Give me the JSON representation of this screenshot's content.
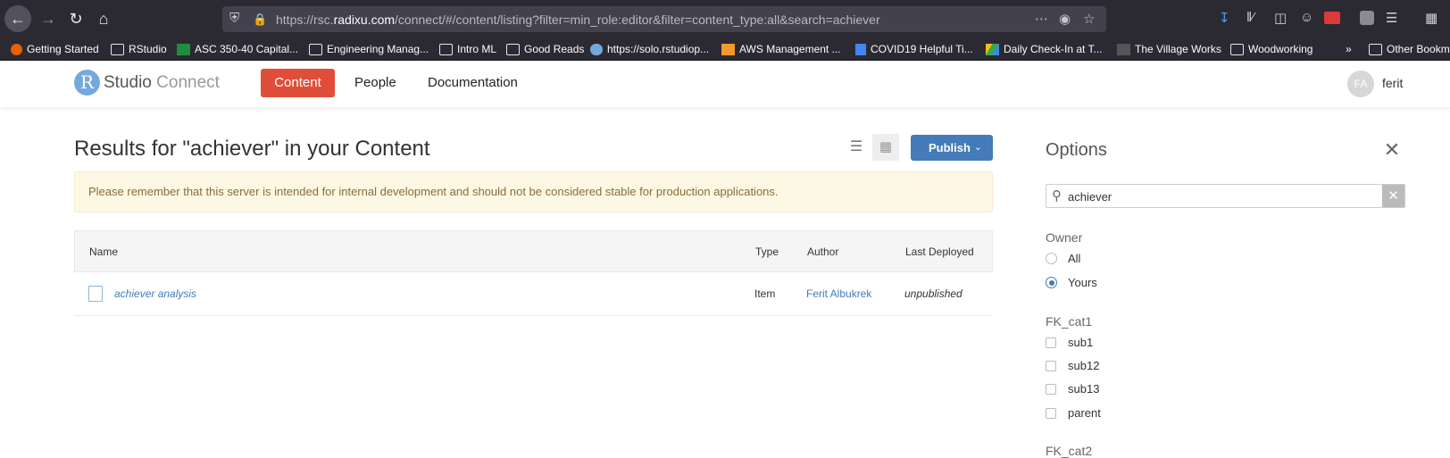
{
  "browser": {
    "url_prefix": "https://rsc.",
    "url_domain": "radixu.com",
    "url_rest": "/connect/#/content/listing?filter=min_role:editor&filter=content_type:all&search=achiever",
    "bookmarks": [
      "Getting Started",
      "RStudio",
      "ASC 350-40 Capital...",
      "Engineering Manag...",
      "Intro ML",
      "Good Reads",
      "https://solo.rstudiop...",
      "AWS Management ...",
      "COVID19 Helpful Ti...",
      "Daily Check-In at T...",
      "The Village Works",
      "Woodworking",
      "Other Bookm"
    ]
  },
  "header": {
    "logo_r": "R",
    "logo_studio": "Studio",
    "logo_connect": "Connect",
    "nav": [
      "Content",
      "People",
      "Documentation"
    ],
    "avatar_initials": "FA",
    "username": "ferit"
  },
  "main": {
    "title": "Results for \"achiever\" in your Content",
    "publish_label": "Publish",
    "alert": "Please remember that this server is intended for internal development and should not be considered stable for production applications.",
    "table": {
      "columns": [
        "Name",
        "Type",
        "Author",
        "Last Deployed"
      ],
      "rows": [
        {
          "name": "achiever analysis",
          "type": "Item",
          "author": "Ferit Albukrek",
          "deployed": "unpublished"
        }
      ]
    }
  },
  "options": {
    "title": "Options",
    "search_value": "achiever",
    "owner_label": "Owner",
    "owner_options": [
      "All",
      "Yours"
    ],
    "owner_selected": "Yours",
    "cat1_label": "FK_cat1",
    "cat1_options": [
      "sub1",
      "sub12",
      "sub13",
      "parent"
    ],
    "cat2_label": "FK_cat2"
  },
  "colors": {
    "accent": "#e04e39",
    "primary": "#447bb8",
    "link": "#447bb8"
  }
}
